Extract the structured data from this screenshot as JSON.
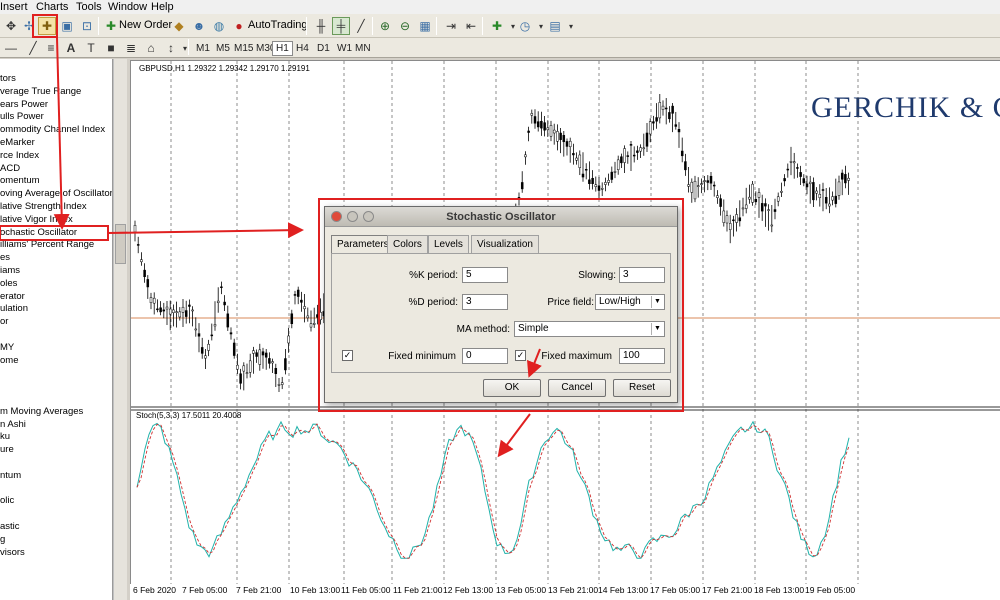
{
  "menu": [
    "Insert",
    "Charts",
    "Tools",
    "Window",
    "Help"
  ],
  "toolbar": {
    "new_order_label": "New Order",
    "autotrading_label": "AutoTrading",
    "timeframes": [
      "M1",
      "M5",
      "M15",
      "M30",
      "H1",
      "H4",
      "D1",
      "W1",
      "MN"
    ],
    "active_timeframe": "H1"
  },
  "navigator": {
    "items": [
      "tors",
      "verage True Range",
      "ears Power",
      "ulls Power",
      "ommodity Channel Index",
      "eMarker",
      "rce Index",
      "ACD",
      "omentum",
      "oving Average of Oscillator",
      "lative Strength Index",
      "lative Vigor Index",
      "ochastic Oscillator",
      "illiams' Percent Range",
      "es",
      "iams",
      "oles",
      "erator",
      "ulation",
      "or",
      "",
      "MY",
      "ome",
      "",
      "",
      "",
      "m Moving Averages",
      "n Ashi",
      "ku",
      "ure",
      "",
      "ntum",
      "",
      "olic",
      "",
      "astic",
      "g",
      "visors"
    ],
    "highlighted_index": 12
  },
  "chart": {
    "title": "GBPUSD,H1  1.29322 1.29342 1.29170 1.29191",
    "brand": "GERCHIK & CO",
    "stoch_title": "Stoch(5,3,3) 17.5011 20.4008",
    "x_labels": [
      "6 Feb 2020",
      "7 Feb 05:00",
      "7 Feb 21:00",
      "10 Feb 13:00",
      "11 Feb 05:00",
      "11 Feb 21:00",
      "12 Feb 13:00",
      "13 Feb 05:00",
      "13 Feb 21:00",
      "14 Feb 13:00",
      "17 Feb 05:00",
      "17 Feb 21:00",
      "18 Feb 13:00",
      "19 Feb 05:00"
    ],
    "colors": {
      "price_line": "#d98a5a",
      "stoch_main": "#20b2aa",
      "stoch_signal": "#d03030",
      "annotation": "#e02020",
      "brand": "#1f3a6d"
    }
  },
  "dialog": {
    "title": "Stochastic Oscillator",
    "tabs": [
      "Parameters",
      "Colors",
      "Levels",
      "Visualization"
    ],
    "active_tab": "Parameters",
    "k_period_label": "%K period:",
    "k_period_value": "5",
    "d_period_label": "%D period:",
    "d_period_value": "3",
    "slowing_label": "Slowing:",
    "slowing_value": "3",
    "price_field_label": "Price field:",
    "price_field_value": "Low/High",
    "ma_method_label": "MA method:",
    "ma_method_value": "Simple",
    "fixed_min_label": "Fixed minimum",
    "fixed_min_value": "0",
    "fixed_min_checked": true,
    "fixed_max_label": "Fixed maximum",
    "fixed_max_value": "100",
    "fixed_max_checked": true,
    "ok_label": "OK",
    "cancel_label": "Cancel",
    "reset_label": "Reset"
  }
}
